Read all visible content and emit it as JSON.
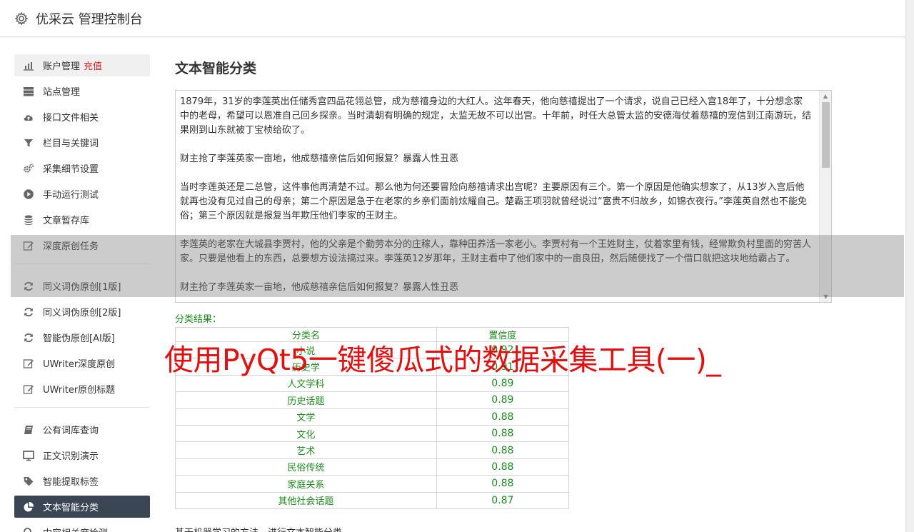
{
  "header": {
    "title": "优采云 管理控制台"
  },
  "sidebar": {
    "group1": [
      {
        "label": "账户管理",
        "badge": "充值",
        "icon": "bar-chart-icon"
      },
      {
        "label": "站点管理",
        "icon": "server-icon"
      },
      {
        "label": "接口文件相关",
        "icon": "cloud-upload-icon"
      },
      {
        "label": "栏目与关键词",
        "icon": "filter-icon"
      },
      {
        "label": "采集细节设置",
        "icon": "cogs-icon"
      },
      {
        "label": "手动运行测试",
        "icon": "play-circle-icon"
      },
      {
        "label": "文章暂存库",
        "icon": "database-icon"
      },
      {
        "label": "深度原创任务",
        "icon": "edit-icon"
      }
    ],
    "group2": [
      {
        "label": "同义词伪原创[1版]",
        "icon": "refresh-icon"
      },
      {
        "label": "同义词伪原创[2版]",
        "icon": "refresh-icon"
      },
      {
        "label": "智能伪原创[AI版]",
        "icon": "refresh-icon"
      },
      {
        "label": "UWriter深度原创",
        "icon": "edit-icon"
      },
      {
        "label": "UWriter原创标题",
        "icon": "edit-icon"
      }
    ],
    "group3": [
      {
        "label": "公有词库查询",
        "icon": "book-icon"
      },
      {
        "label": "正文识别演示",
        "icon": "monitor-icon"
      },
      {
        "label": "智能提取标签",
        "icon": "tag-icon"
      },
      {
        "label": "文本智能分类",
        "icon": "pie-chart-icon"
      },
      {
        "label": "内容相关度检测",
        "icon": "search-icon"
      }
    ]
  },
  "main": {
    "title": "文本智能分类",
    "text_paragraphs": [
      "1879年，31岁的李莲英出任储秀宫四品花翎总管，成为慈禧身边的大红人。这年春天，他向慈禧提出了一个请求，说自己已经入宫18年了，十分想念家中的老母，希望可以恩准自己回乡探亲。当时清朝有明确的规定，太监无故不可以出宫。十年前，时任大总管太监的安德海仗着慈禧的宠信到江南游玩，结果刚到山东就被丁宝桢给砍了。",
      "财主抢了李莲英家一亩地，他成慈禧亲信后如何报复？暴露人性丑恶",
      "当时李莲英还是二总管，这件事他再清楚不过。那么他为何还要冒险向慈禧请求出宫呢？主要原因有三个。第一个原因是他确实想家了，从13岁入宫后他就再也没有见过自己的母亲；第二个原因是急于在老家的乡亲们面前炫耀自己。楚霸王项羽就曾经说过“富贵不归故乡，如锦衣夜行。”李莲英自然也不能免俗；第三个原因就是报复当年欺压他们李家的王财主。",
      "李莲英的老家在大城县李贾村，他的父亲是个勤劳本分的庄稼人，靠种田养活一家老小。李贾村有一个王姓财主，仗着家里有钱，经常欺负村里面的穷苦人家。只要是他看上的东西，总要想方设法搞过来。李莲英12岁那年，王财主看中了他们家中的一亩良田，然后随便找了一个借口就把这块地给霸占了。",
      "财主抢了李莲英家一亩地，他成慈禧亲信后如何报复？暴露人性丑恶"
    ],
    "result_label": "分类结果：",
    "table": {
      "headers": [
        "分类名",
        "置信度"
      ],
      "rows": [
        [
          "小说",
          "0.92"
        ],
        [
          "历史学",
          "0.91"
        ],
        [
          "人文学科",
          "0.89"
        ],
        [
          "历史话题",
          "0.89"
        ],
        [
          "文学",
          "0.88"
        ],
        [
          "文化",
          "0.88"
        ],
        [
          "艺术",
          "0.88"
        ],
        [
          "民俗传统",
          "0.88"
        ],
        [
          "家庭关系",
          "0.88"
        ],
        [
          "其他社会话题",
          "0.87"
        ]
      ]
    },
    "footnote": "基于机器学习的方法，进行文本智能分类。"
  },
  "watermark": "使用PyQt5一键傻瓜式的数据采集工具(一)_",
  "colors": {
    "accent_green": "#1e8a1e",
    "active_nav": "#3b4654",
    "recharge_red": "#e02020",
    "watermark_red": "#e01010"
  }
}
